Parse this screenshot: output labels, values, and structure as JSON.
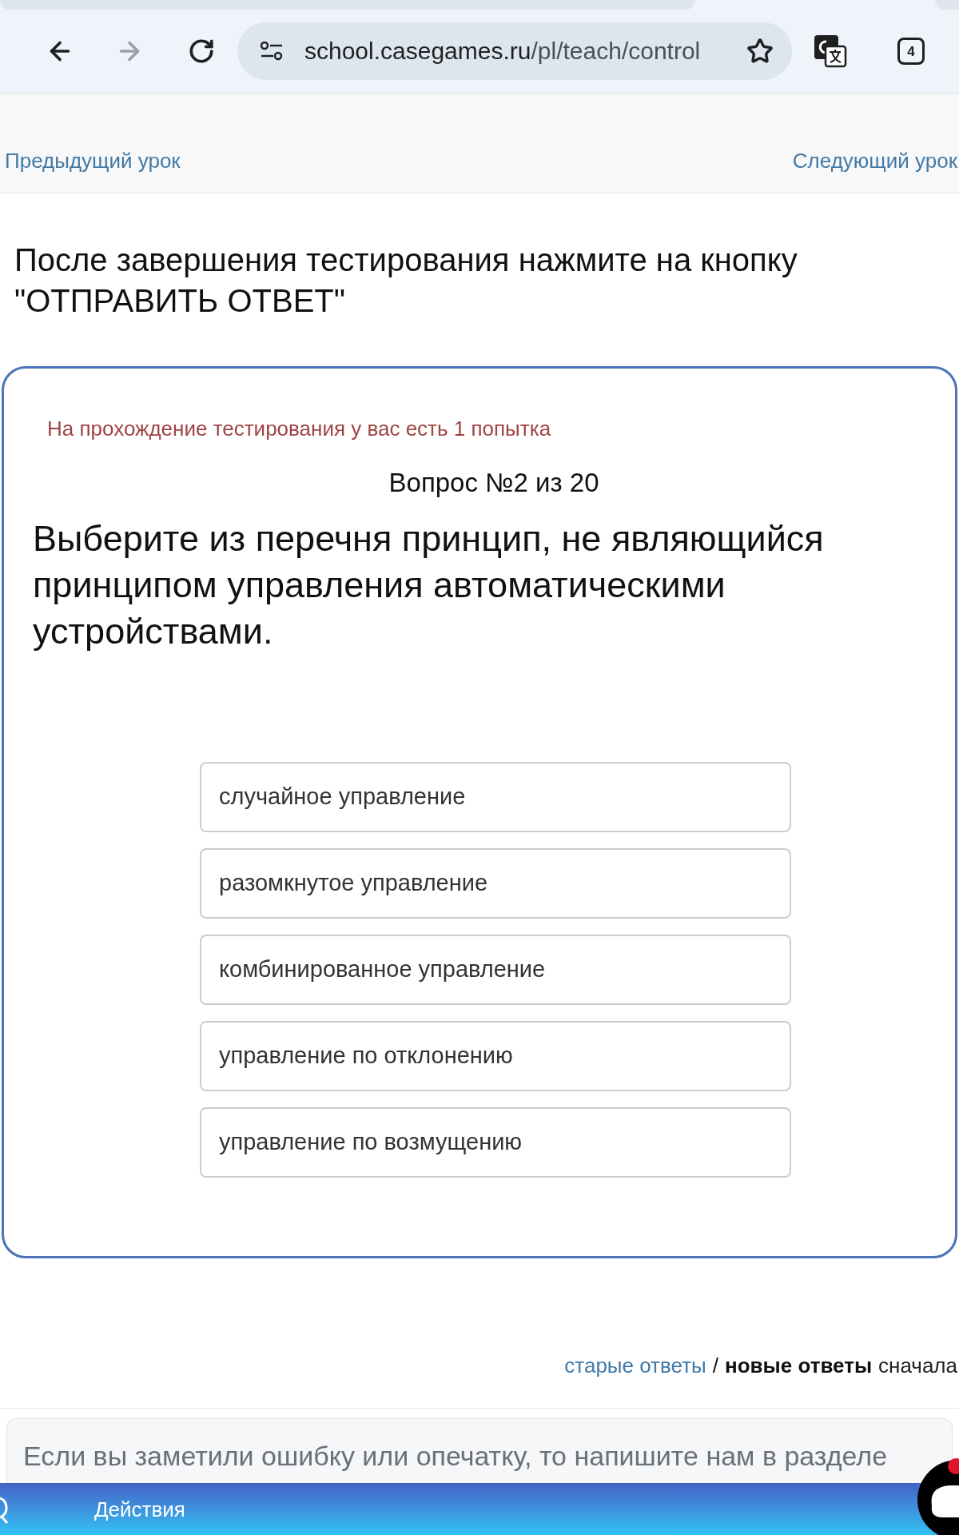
{
  "browser": {
    "url_host": "school.casegames.ru",
    "url_path": "/pl/teach/control",
    "tab_count": "4"
  },
  "lesson_nav": {
    "previous": "Предыдущий урок",
    "next": "Следующий урок"
  },
  "instruction": "После завершения тестирования нажмите на кнопку \"ОТПРАВИТЬ ОТВЕТ\"",
  "quiz": {
    "attempts_note": "На прохождение тестирования у вас есть 1 попытка",
    "counter": "Вопрос №2 из 20",
    "question": "Выберите из перечня принцип, не являющийся принципом управления автоматическими устройствами.",
    "options": [
      {
        "label": "случайное управление",
        "selected": false
      },
      {
        "label": "разомкнутое управление",
        "selected": false
      },
      {
        "label": "комбинированное управление",
        "selected": false
      },
      {
        "label": "управление по отклонению",
        "selected": false
      },
      {
        "label": "управление по возмущению",
        "selected": false
      }
    ]
  },
  "comments": {
    "sort_options": [
      {
        "label": "старые ответы",
        "selected": false
      },
      {
        "label": "новые ответы",
        "selected": true
      }
    ],
    "separator": "/",
    "sort_suffix": "сначала",
    "notice": "Если вы заметили ошибку или опечатку, то напишите нам в разделе"
  },
  "bottom_bar": {
    "label": "Действия"
  }
}
